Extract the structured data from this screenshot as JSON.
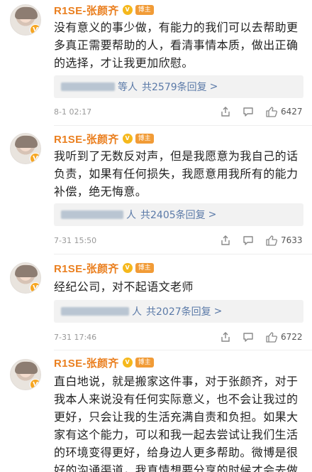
{
  "comments": [
    {
      "username": "R1SE-张颜齐",
      "medal_glyph": "V",
      "role": "博主",
      "text": "没有意义的事少做，有能力的我们可以去帮助更多真正需要帮助的人，看清事情本质，做出正确的选择，才让我更加欣慰。",
      "reply_suffix": "等人",
      "reply_count": "共2579条回复",
      "reply_arrow": ">",
      "time": "8-1 02:17",
      "likes": "6427"
    },
    {
      "username": "R1SE-张颜齐",
      "medal_glyph": "V",
      "role": "博主",
      "text": "我听到了无数反对声，但是我愿意为我自己的话负责，如果有任何损失，我愿意用我所有的能力补偿，绝无悔意。",
      "reply_suffix": "人",
      "reply_count": "共2405条回复",
      "reply_arrow": ">",
      "time": "7-31 15:50",
      "likes": "7633"
    },
    {
      "username": "R1SE-张颜齐",
      "medal_glyph": "V",
      "role": "博主",
      "text": "经纪公司，对不起语文老师",
      "reply_suffix": "人",
      "reply_count": "共2027条回复",
      "reply_arrow": ">",
      "time": "7-31 17:46",
      "likes": "6722"
    },
    {
      "username": "R1SE-张颜齐",
      "medal_glyph": "V",
      "role": "博主",
      "text": "直白地说，就是搬家这件事，对于张颜齐，对于我本人来说没有任何实际意义，也不会让我过的更好，只会让我的生活充满自责和负担。如果大家有这个能力，可以和我一起去尝试让我们生活的环境变得更好，给身边人更多帮助。微博是很好的沟通渠道，我真情想要分享的时候才会去做"
    }
  ],
  "colors": {
    "username": "#ea7f1f",
    "link": "#5b7aa8",
    "reply_bg": "#f2f2f2",
    "badge": "#f19b36"
  },
  "icons": [
    "share-icon",
    "comment-icon",
    "thumbs-up-icon"
  ]
}
